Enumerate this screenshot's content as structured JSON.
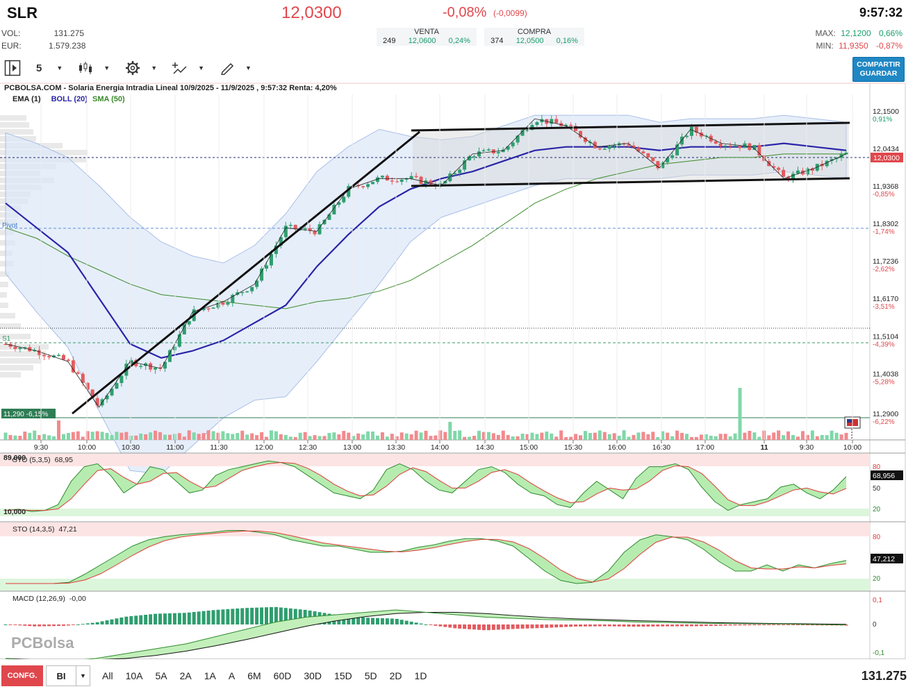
{
  "header": {
    "ticker": "SLR",
    "price": "12,0300",
    "change_pct": "-0,08%",
    "change_abs": "(-0,0099)",
    "time": "9:57:32",
    "vol_label": "VOL:",
    "vol_value": "131.275",
    "eur_label": "EUR:",
    "eur_value": "1.579.238",
    "sell": {
      "label": "VENTA",
      "qty": "249",
      "price": "12,0600",
      "pct": "0,24%"
    },
    "buy": {
      "label": "COMPRA",
      "qty": "374",
      "price": "12,0500",
      "pct": "0,16%"
    },
    "max_label": "MAX:",
    "max_value": "12,1200",
    "max_pct": "0,66%",
    "min_label": "MIN:",
    "min_value": "11,9350",
    "min_pct": "-0,87%"
  },
  "toolbar": {
    "interval": "5",
    "share_line1": "COMPARTIR",
    "share_line2": "GUARDAR",
    "icons": [
      "play-panel-icon",
      "candles-icon",
      "gear-icon",
      "indicators-icon",
      "draw-pen-icon"
    ]
  },
  "main_chart": {
    "title": "PCBOLSA.COM - Solaria Energia Intradia Lineal 10/9/2025 - 11/9/2025 , 9:57:32 Renta: 4,20%",
    "legend_ema": "EMA (1)",
    "legend_boll": "BOLL (20)",
    "legend_sma": "SMA (50)",
    "pivot_label": "Pivot",
    "s1_label": "S1",
    "low_marker": "11,290  -6,15%",
    "last_price_tag": "12,0300",
    "y_ticks": [
      {
        "value": "12,1500",
        "pct": "0,91%"
      },
      {
        "value": "12,0434",
        "pct": ""
      },
      {
        "value": "11,9368",
        "pct": "-0,85%"
      },
      {
        "value": "11,8302",
        "pct": "-1,74%"
      },
      {
        "value": "11,7236",
        "pct": "-2,62%"
      },
      {
        "value": "11,6170",
        "pct": "-3,51%"
      },
      {
        "value": "11,5104",
        "pct": "-4,39%"
      },
      {
        "value": "11,4038",
        "pct": "-5,28%"
      },
      {
        "value": "11,2900",
        "pct": "-6,22%"
      }
    ],
    "x_ticks": [
      "9:30",
      "10:00",
      "10:30",
      "11:00",
      "11:30",
      "12:00",
      "12:30",
      "13:00",
      "13:30",
      "14:00",
      "14:30",
      "15:00",
      "15:30",
      "16:00",
      "16:30",
      "17:00",
      "11",
      "9:30",
      "10:00"
    ]
  },
  "sto1": {
    "label": "STO (5,3,5)",
    "value": "68,95",
    "tag": "68,956",
    "top_text": "89,000",
    "bottom_text": "10,000",
    "levels": [
      "80",
      "50",
      "20"
    ]
  },
  "sto2": {
    "label": "STO (14,3,5)",
    "value": "47,21",
    "tag": "47,212",
    "levels": [
      "80",
      "20"
    ]
  },
  "macd": {
    "label": "MACD (12,26,9)",
    "value": "-0,00",
    "levels": [
      "0,1",
      "0",
      "-0,1"
    ],
    "watermark": "PCBolsa"
  },
  "bottom": {
    "config": "CONFG.",
    "bi": "BI",
    "ranges": [
      "All",
      "10A",
      "5A",
      "2A",
      "1A",
      "A",
      "6M",
      "60D",
      "30D",
      "15D",
      "5D",
      "2D",
      "1D"
    ],
    "total_volume": "131.275"
  },
  "chart_data": {
    "type": "line",
    "title": "PCBOLSA.COM - Solaria Energia Intradia Lineal 10/9/2025 - 11/9/2025 , 9:57:32 Renta: 4,20%",
    "xlabel": "",
    "ylabel": "",
    "ylim": [
      11.27,
      12.17
    ],
    "x": [
      "9:10",
      "9:30",
      "9:45",
      "10:00",
      "10:10",
      "10:30",
      "10:45",
      "11:00",
      "11:15",
      "11:30",
      "11:45",
      "12:00",
      "12:30",
      "13:00",
      "13:20",
      "13:40",
      "14:00",
      "14:30",
      "14:45",
      "15:00",
      "15:30",
      "16:00",
      "16:30",
      "17:00",
      "17:25",
      "9:10",
      "9:30",
      "9:50"
    ],
    "series": [
      {
        "name": "EMA (1)",
        "values": [
          11.49,
          11.47,
          11.44,
          11.31,
          11.44,
          11.42,
          11.58,
          11.61,
          11.66,
          11.82,
          11.81,
          11.93,
          11.96,
          11.96,
          11.94,
          12.03,
          12.04,
          12.13,
          12.11,
          12.05,
          12.06,
          11.99,
          12.1,
          12.06,
          12.05,
          11.96,
          11.99,
          12.03
        ]
      },
      {
        "name": "BOLL (20)",
        "values": [
          11.89,
          11.82,
          11.75,
          11.62,
          11.49,
          11.45,
          11.47,
          11.5,
          11.55,
          11.6,
          11.71,
          11.8,
          11.88,
          11.93,
          11.96,
          11.98,
          12.01,
          12.04,
          12.05,
          12.05,
          12.05,
          12.04,
          12.05,
          12.05,
          12.05,
          12.06,
          12.05,
          12.04
        ]
      },
      {
        "name": "SMA (50)",
        "values": [
          11.82,
          11.79,
          11.74,
          11.7,
          11.66,
          11.63,
          11.62,
          11.61,
          11.6,
          11.59,
          11.61,
          11.62,
          11.64,
          11.67,
          11.72,
          11.77,
          11.83,
          11.89,
          11.93,
          11.96,
          11.98,
          12.0,
          12.01,
          12.02,
          12.02,
          12.03,
          12.03,
          12.03
        ]
      }
    ],
    "pivot": 11.83,
    "s1": 11.51,
    "last": 12.03
  }
}
